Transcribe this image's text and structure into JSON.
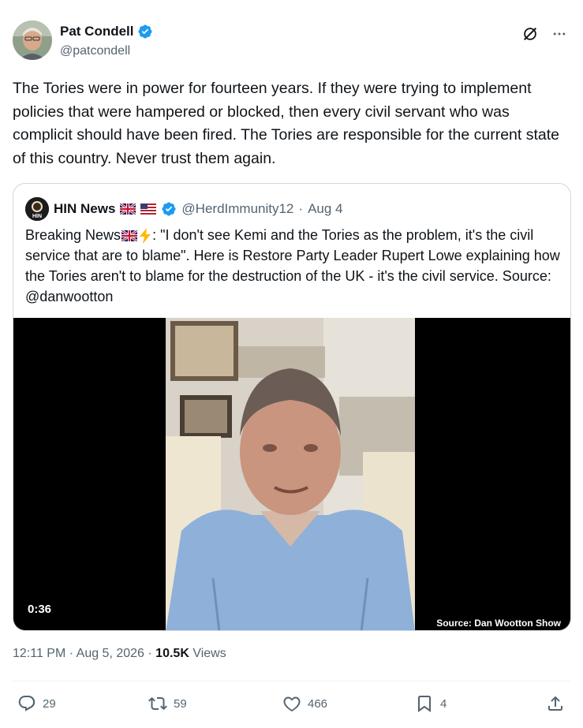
{
  "author": {
    "display_name": "Pat Condell",
    "handle": "@patcondell",
    "verified_icon": "verified-badge-icon"
  },
  "header_actions": {
    "grok_icon": "grok-icon",
    "more_icon": "more-icon"
  },
  "tweet": {
    "text": "The Tories were in power for fourteen years. If they were trying to implement policies that were hampered or blocked, then every civil servant who was complicit should have been fired. The Tories are responsible for the current state of this country. Never trust them again."
  },
  "quote": {
    "display_name": "HIN News",
    "avatar_text": "HIN",
    "handle": "@HerdImmunity12",
    "separator": "·",
    "date": "Aug 4",
    "text_prefix": "Breaking News",
    "text_body": ": \"I don't see Kemi and the Tories as the problem, it's the civil service that are to blame\". Here is Restore Party Leader Rupert Lowe explaining how the Tories aren't to blame for the destruction of the UK - it's the civil service. Source: @danwootton",
    "video": {
      "duration": "0:36",
      "source_label": "Source: Dan Wootton Show"
    }
  },
  "meta": {
    "time": "12:11 PM",
    "sep1": "·",
    "date": "Aug 5, 2026",
    "sep2": "·",
    "views_count": "10.5K",
    "views_label": "Views"
  },
  "actions": {
    "replies": "29",
    "reposts": "59",
    "likes": "466",
    "bookmarks": "4"
  },
  "colors": {
    "text_primary": "#0f1419",
    "text_secondary": "#536471",
    "verified_blue": "#1d9bf0",
    "border": "#cfd9de"
  }
}
